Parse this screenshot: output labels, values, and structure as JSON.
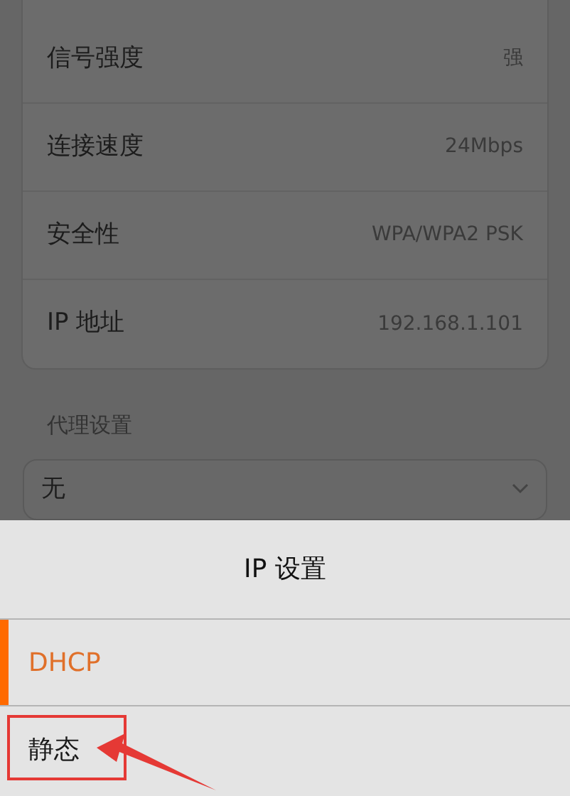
{
  "wifi_details": [
    {
      "label": "信号强度",
      "value": "强"
    },
    {
      "label": "连接速度",
      "value": "24Mbps"
    },
    {
      "label": "安全性",
      "value": "WPA/WPA2 PSK"
    },
    {
      "label": "IP 地址",
      "value": "192.168.1.101"
    }
  ],
  "proxy": {
    "section_label": "代理设置",
    "value": "无"
  },
  "ip_sheet": {
    "title": "IP 设置",
    "options": [
      {
        "label": "DHCP",
        "selected": true,
        "annotated": false
      },
      {
        "label": "静态",
        "selected": false,
        "annotated": true
      }
    ]
  }
}
